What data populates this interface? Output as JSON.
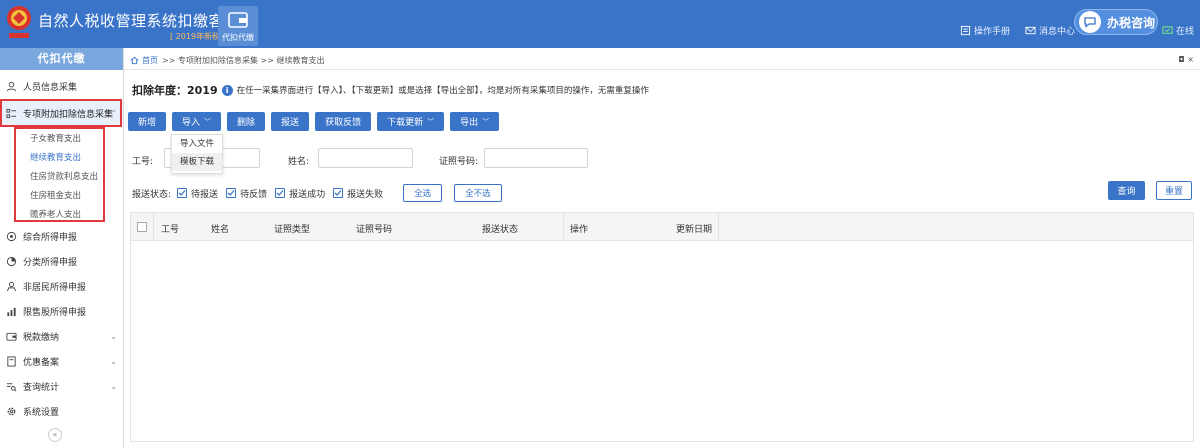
{
  "header": {
    "title": "自然人税收管理系统扣缴客户端",
    "version": "[ 2019年新税制 ]",
    "module_tab": "代扣代缴",
    "links": [
      {
        "label": "操作手册",
        "icon": "book-icon"
      },
      {
        "label": "消息中心",
        "icon": "mail-icon"
      },
      {
        "label": "在线",
        "icon": "chat-icon"
      }
    ],
    "consult_label": "办税咨询"
  },
  "sidebar": {
    "title": "代扣代缴",
    "items": [
      {
        "label": "人员信息采集",
        "icon": "person-icon"
      },
      {
        "label": "专项附加扣除信息采集",
        "icon": "list-icon"
      },
      {
        "label": "综合所得申报",
        "icon": "gear-circle-icon"
      },
      {
        "label": "分类所得申报",
        "icon": "pie-icon"
      },
      {
        "label": "非居民所得申报",
        "icon": "user-icon"
      },
      {
        "label": "限售股所得申报",
        "icon": "bar-chart-icon"
      },
      {
        "label": "税款缴纳",
        "icon": "wallet-icon"
      },
      {
        "label": "优惠备案",
        "icon": "document-icon"
      },
      {
        "label": "查询统计",
        "icon": "search-list-icon"
      },
      {
        "label": "系统设置",
        "icon": "settings-icon"
      }
    ],
    "sub_items": [
      "子女教育支出",
      "继续教育支出",
      "住房贷款利息支出",
      "住房租金支出",
      "赡养老人支出"
    ],
    "collapse_label": "«"
  },
  "breadcrumb": {
    "home": "首页",
    "path": ">> 专项附加扣除信息采集 >> 继续教育支出",
    "controls": "◘ ×"
  },
  "info": {
    "year_label": "扣除年度：2019",
    "message": "在任一采集界面进行【导入】、【下载更新】或是选择【导出全部】，均是对所有采集项目的操作，无需重复操作"
  },
  "toolbar": {
    "add": "新增",
    "import": "导入",
    "delete": "删除",
    "submit": "报送",
    "feedback": "获取反馈",
    "download": "下载更新",
    "export": "导出"
  },
  "import_menu": [
    "导入文件",
    "模板下载"
  ],
  "search": {
    "job_no": "工号:",
    "name": "姓名:",
    "id_no": "证照号码:",
    "status_label": "报送状态:",
    "statuses": [
      "待报送",
      "待反馈",
      "报送成功",
      "报送失败"
    ],
    "select_all": "全选",
    "select_none": "全不选",
    "query": "查询",
    "reset": "重置"
  },
  "table": {
    "columns": [
      "工号",
      "姓名",
      "证照类型",
      "证照号码",
      "报送状态",
      "操作",
      "更新日期"
    ]
  },
  "colors": {
    "primary": "#3a74c9",
    "sidebar_title": "#7aa7de",
    "highlight_border": "#e0393e"
  }
}
